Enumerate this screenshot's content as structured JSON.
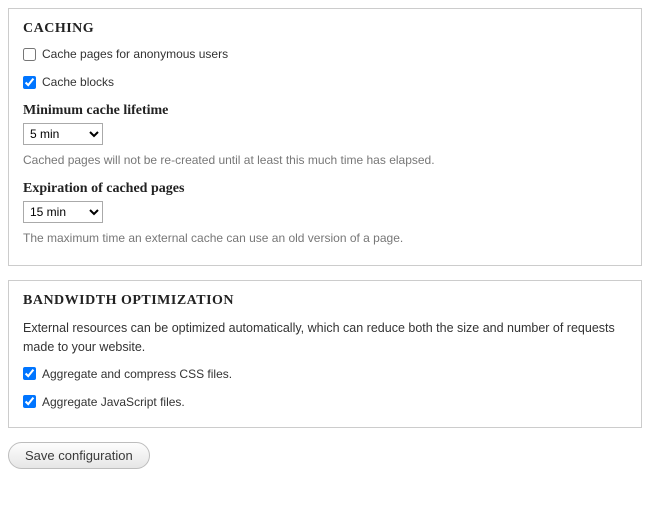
{
  "caching": {
    "title": "CACHING",
    "anonymous": {
      "label": "Cache pages for anonymous users",
      "checked": false
    },
    "blocks": {
      "label": "Cache blocks",
      "checked": true
    },
    "min_lifetime": {
      "label": "Minimum cache lifetime",
      "value": "5 min",
      "description": "Cached pages will not be re-created until at least this much time has elapsed."
    },
    "expiration": {
      "label": "Expiration of cached pages",
      "value": "15 min",
      "description": "The maximum time an external cache can use an old version of a page."
    }
  },
  "bandwidth": {
    "title": "BANDWIDTH OPTIMIZATION",
    "intro": "External resources can be optimized automatically, which can reduce both the size and number of requests made to your website.",
    "aggregate_css": {
      "label": "Aggregate and compress CSS files.",
      "checked": true
    },
    "aggregate_js": {
      "label": "Aggregate JavaScript files.",
      "checked": true
    }
  },
  "actions": {
    "save_label": "Save configuration"
  }
}
